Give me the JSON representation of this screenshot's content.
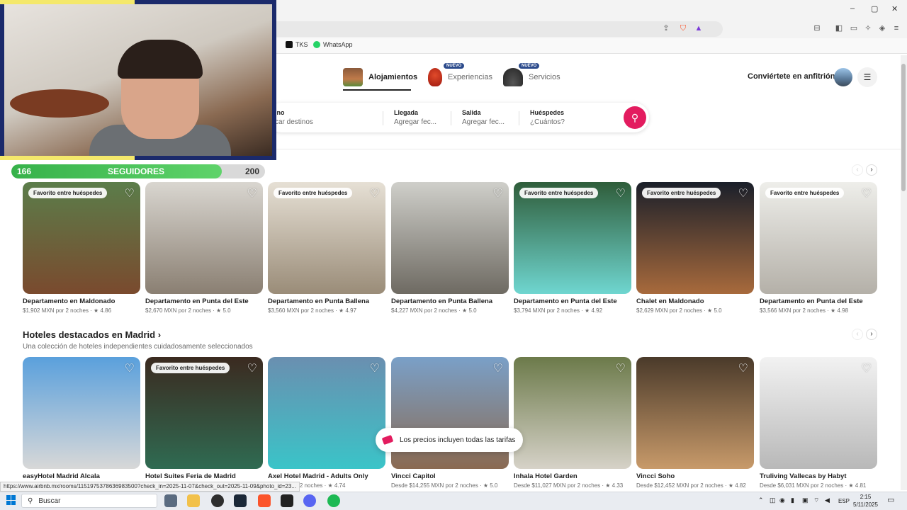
{
  "browser": {
    "bookmarks": [
      {
        "label": "TKS",
        "color": "#111111"
      },
      {
        "label": "WhatsApp",
        "color": "#25d366"
      }
    ],
    "window_controls": {
      "minimize": "–",
      "maximize": "▢",
      "close": "✕"
    },
    "status_url": "https://www.airbnb.mx/rooms/1151975378636983500?check_in=2025-11-07&check_out=2025-11-09&photo_id=23..."
  },
  "overlay": {
    "followers_current": "166",
    "followers_label": "SEGUIDORES",
    "followers_goal": "200",
    "progress_fraction": 0.83
  },
  "header": {
    "tabs": [
      {
        "label": "Alojamientos",
        "badge": ""
      },
      {
        "label": "Experiencias",
        "badge": "NUEVO"
      },
      {
        "label": "Servicios",
        "badge": "NUEVO"
      }
    ],
    "host_link": "Conviértete en anfitrión",
    "menu_icon": "☰"
  },
  "search": {
    "fields": [
      {
        "label": "ino",
        "value": "car destinos"
      },
      {
        "label": "Llegada",
        "value": "Agregar fec..."
      },
      {
        "label": "Salida",
        "value": "Agregar fec..."
      },
      {
        "label": "Huéspedes",
        "value": "¿Cuántos?"
      }
    ],
    "button_icon": "⚲"
  },
  "section1": {
    "prev_icon": "‹",
    "next_icon": "›",
    "cards": [
      {
        "title": "Departamento en Maldonado",
        "sub": "$1,902 MXN por 2 noches · ★ 4.86",
        "pill": "Favorito entre huéspedes",
        "c1": "#5b7d4a",
        "c2": "#7a4a2e"
      },
      {
        "title": "Departamento en Punta del Este",
        "sub": "$2,670 MXN por 2 noches · ★ 5.0",
        "pill": "",
        "c1": "#d9d6d0",
        "c2": "#8a7f72"
      },
      {
        "title": "Departamento en Punta Ballena",
        "sub": "$3,560 MXN por 2 noches · ★ 4.97",
        "pill": "Favorito entre huéspedes",
        "c1": "#e6e0d5",
        "c2": "#9a8c78"
      },
      {
        "title": "Departamento en Punta Ballena",
        "sub": "$4,227 MXN por 2 noches · ★ 5.0",
        "pill": "",
        "c1": "#cfcfca",
        "c2": "#6e6a62"
      },
      {
        "title": "Departamento en Punta del Este",
        "sub": "$3,794 MXN por 2 noches · ★ 4.92",
        "pill": "Favorito entre huéspedes",
        "c1": "#2f5d3a",
        "c2": "#6fd6d0"
      },
      {
        "title": "Chalet en Maldonado",
        "sub": "$2,629 MXN por 2 noches · ★ 5.0",
        "pill": "Favorito entre huéspedes",
        "c1": "#1a1f2a",
        "c2": "#a86a3c"
      },
      {
        "title": "Departamento en Punta del Este",
        "sub": "$3,566 MXN por 2 noches · ★ 4.98",
        "pill": "Favorito entre huéspedes",
        "c1": "#eeeeea",
        "c2": "#b4b0a8"
      }
    ]
  },
  "section2": {
    "title": "Hoteles destacados en Madrid ›",
    "subtitle": "Una colección de hoteles independientes cuidadosamente seleccionados",
    "prev_icon": "‹",
    "next_icon": "›",
    "cards": [
      {
        "title": "easyHotel Madrid Alcala",
        "sub": "",
        "pill": "",
        "c1": "#5aa0dc",
        "c2": "#d8d8d8"
      },
      {
        "title": "Hotel Suites Feria de Madrid",
        "sub": "",
        "pill": "Favorito entre huéspedes",
        "c1": "#3b2a20",
        "c2": "#2f6b52"
      },
      {
        "title": "Axel Hotel Madrid - Adults Only",
        "sub": "02 MXN por 2 noches · ★ 4.74",
        "pill": "",
        "c1": "#6a8fb0",
        "c2": "#3ac4c8"
      },
      {
        "title": "Vincci Capitol",
        "sub": "Desde $14,255 MXN por 2 noches · ★ 5.0",
        "pill": "",
        "c1": "#7aa0c8",
        "c2": "#8a6a52"
      },
      {
        "title": "Inhala Hotel Garden",
        "sub": "Desde $11,027 MXN por 2 noches · ★ 4.33",
        "pill": "",
        "c1": "#6c7a4a",
        "c2": "#d6d2c8"
      },
      {
        "title": "Vincci Soho",
        "sub": "Desde $12,452 MXN por 2 noches · ★ 4.82",
        "pill": "",
        "c1": "#4a3a2a",
        "c2": "#c89a6a"
      },
      {
        "title": "Truliving Vallecas by Habyt",
        "sub": "Desde $6,031 MXN por 2 noches · ★ 4.81",
        "pill": "",
        "c1": "#f2f2f2",
        "c2": "#b8b8b8"
      }
    ]
  },
  "toast": {
    "text": "Los precios incluyen todas las tarifas"
  },
  "taskbar": {
    "search_placeholder": "Buscar",
    "lang": "ESP",
    "time": "2:15",
    "date": "5/11/2025"
  }
}
